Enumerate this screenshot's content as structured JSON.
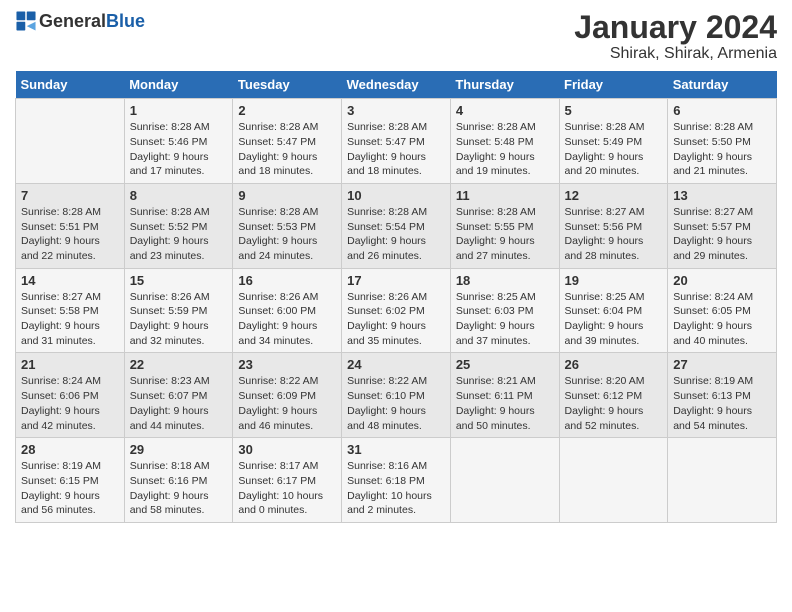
{
  "header": {
    "logo_general": "General",
    "logo_blue": "Blue",
    "title": "January 2024",
    "subtitle": "Shirak, Shirak, Armenia"
  },
  "calendar": {
    "days_of_week": [
      "Sunday",
      "Monday",
      "Tuesday",
      "Wednesday",
      "Thursday",
      "Friday",
      "Saturday"
    ],
    "weeks": [
      [
        {
          "day": "",
          "info": ""
        },
        {
          "day": "1",
          "info": "Sunrise: 8:28 AM\nSunset: 5:46 PM\nDaylight: 9 hours\nand 17 minutes."
        },
        {
          "day": "2",
          "info": "Sunrise: 8:28 AM\nSunset: 5:47 PM\nDaylight: 9 hours\nand 18 minutes."
        },
        {
          "day": "3",
          "info": "Sunrise: 8:28 AM\nSunset: 5:47 PM\nDaylight: 9 hours\nand 18 minutes."
        },
        {
          "day": "4",
          "info": "Sunrise: 8:28 AM\nSunset: 5:48 PM\nDaylight: 9 hours\nand 19 minutes."
        },
        {
          "day": "5",
          "info": "Sunrise: 8:28 AM\nSunset: 5:49 PM\nDaylight: 9 hours\nand 20 minutes."
        },
        {
          "day": "6",
          "info": "Sunrise: 8:28 AM\nSunset: 5:50 PM\nDaylight: 9 hours\nand 21 minutes."
        }
      ],
      [
        {
          "day": "7",
          "info": "Sunrise: 8:28 AM\nSunset: 5:51 PM\nDaylight: 9 hours\nand 22 minutes."
        },
        {
          "day": "8",
          "info": "Sunrise: 8:28 AM\nSunset: 5:52 PM\nDaylight: 9 hours\nand 23 minutes."
        },
        {
          "day": "9",
          "info": "Sunrise: 8:28 AM\nSunset: 5:53 PM\nDaylight: 9 hours\nand 24 minutes."
        },
        {
          "day": "10",
          "info": "Sunrise: 8:28 AM\nSunset: 5:54 PM\nDaylight: 9 hours\nand 26 minutes."
        },
        {
          "day": "11",
          "info": "Sunrise: 8:28 AM\nSunset: 5:55 PM\nDaylight: 9 hours\nand 27 minutes."
        },
        {
          "day": "12",
          "info": "Sunrise: 8:27 AM\nSunset: 5:56 PM\nDaylight: 9 hours\nand 28 minutes."
        },
        {
          "day": "13",
          "info": "Sunrise: 8:27 AM\nSunset: 5:57 PM\nDaylight: 9 hours\nand 29 minutes."
        }
      ],
      [
        {
          "day": "14",
          "info": "Sunrise: 8:27 AM\nSunset: 5:58 PM\nDaylight: 9 hours\nand 31 minutes."
        },
        {
          "day": "15",
          "info": "Sunrise: 8:26 AM\nSunset: 5:59 PM\nDaylight: 9 hours\nand 32 minutes."
        },
        {
          "day": "16",
          "info": "Sunrise: 8:26 AM\nSunset: 6:00 PM\nDaylight: 9 hours\nand 34 minutes."
        },
        {
          "day": "17",
          "info": "Sunrise: 8:26 AM\nSunset: 6:02 PM\nDaylight: 9 hours\nand 35 minutes."
        },
        {
          "day": "18",
          "info": "Sunrise: 8:25 AM\nSunset: 6:03 PM\nDaylight: 9 hours\nand 37 minutes."
        },
        {
          "day": "19",
          "info": "Sunrise: 8:25 AM\nSunset: 6:04 PM\nDaylight: 9 hours\nand 39 minutes."
        },
        {
          "day": "20",
          "info": "Sunrise: 8:24 AM\nSunset: 6:05 PM\nDaylight: 9 hours\nand 40 minutes."
        }
      ],
      [
        {
          "day": "21",
          "info": "Sunrise: 8:24 AM\nSunset: 6:06 PM\nDaylight: 9 hours\nand 42 minutes."
        },
        {
          "day": "22",
          "info": "Sunrise: 8:23 AM\nSunset: 6:07 PM\nDaylight: 9 hours\nand 44 minutes."
        },
        {
          "day": "23",
          "info": "Sunrise: 8:22 AM\nSunset: 6:09 PM\nDaylight: 9 hours\nand 46 minutes."
        },
        {
          "day": "24",
          "info": "Sunrise: 8:22 AM\nSunset: 6:10 PM\nDaylight: 9 hours\nand 48 minutes."
        },
        {
          "day": "25",
          "info": "Sunrise: 8:21 AM\nSunset: 6:11 PM\nDaylight: 9 hours\nand 50 minutes."
        },
        {
          "day": "26",
          "info": "Sunrise: 8:20 AM\nSunset: 6:12 PM\nDaylight: 9 hours\nand 52 minutes."
        },
        {
          "day": "27",
          "info": "Sunrise: 8:19 AM\nSunset: 6:13 PM\nDaylight: 9 hours\nand 54 minutes."
        }
      ],
      [
        {
          "day": "28",
          "info": "Sunrise: 8:19 AM\nSunset: 6:15 PM\nDaylight: 9 hours\nand 56 minutes."
        },
        {
          "day": "29",
          "info": "Sunrise: 8:18 AM\nSunset: 6:16 PM\nDaylight: 9 hours\nand 58 minutes."
        },
        {
          "day": "30",
          "info": "Sunrise: 8:17 AM\nSunset: 6:17 PM\nDaylight: 10 hours\nand 0 minutes."
        },
        {
          "day": "31",
          "info": "Sunrise: 8:16 AM\nSunset: 6:18 PM\nDaylight: 10 hours\nand 2 minutes."
        },
        {
          "day": "",
          "info": ""
        },
        {
          "day": "",
          "info": ""
        },
        {
          "day": "",
          "info": ""
        }
      ]
    ]
  }
}
